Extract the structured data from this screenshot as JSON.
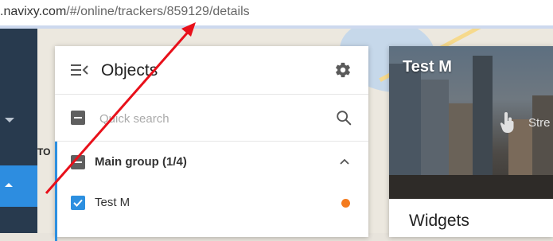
{
  "browser": {
    "url_host": ".navixy.com",
    "url_path": "/#/online/trackers/859129/details"
  },
  "map": {
    "partial_label": "TO"
  },
  "objects_panel": {
    "title": "Objects",
    "search": {
      "placeholder": "Quick search",
      "value": ""
    },
    "group": {
      "label": "Main group (1/4)",
      "expanded": true,
      "selection": "partial"
    },
    "items": [
      {
        "label": "Test M",
        "checked": true,
        "status_color": "#f47b1e"
      }
    ]
  },
  "tracker_card": {
    "title": "Test M",
    "street_view_label": "Stre",
    "widgets_heading": "Widgets"
  },
  "colors": {
    "accent": "#2c8fe0",
    "sidebar": "#283a4e",
    "arrow": "#e8101a",
    "status_online": "#f47b1e"
  },
  "icons": [
    "menu-collapse-icon",
    "gear-icon",
    "search-icon",
    "chevron-up-icon",
    "chevron-down-icon",
    "hand-pointer-icon"
  ]
}
